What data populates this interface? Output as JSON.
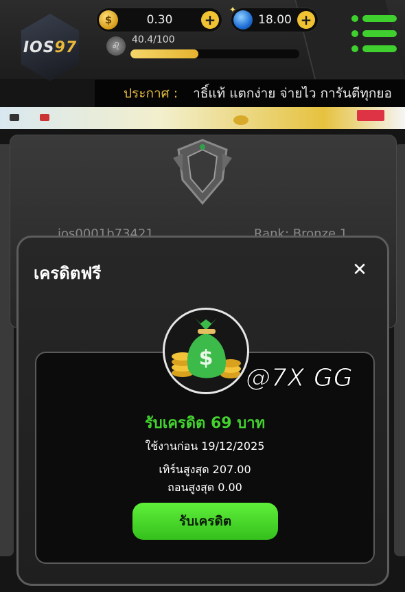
{
  "header": {
    "logo_text_main": "IOS",
    "logo_text_num": "97",
    "coin_balance": "0.30",
    "gem_balance": "18.00",
    "exp_text": "40.4/100",
    "exp_progress": 0.404,
    "coin_symbol": "$",
    "plus_symbol": "+"
  },
  "announcement": {
    "label": "ประกาศ :",
    "text": "าธิ์แท้ แตกง่าย จ่ายไว การันตีทุกยอ"
  },
  "profile": {
    "username": "ios0001b73421",
    "rank": "Rank: Bronze 1"
  },
  "modal": {
    "title": "เครดิตฟรี",
    "close_symbol": "✕",
    "reward_title": "รับเครดิต 69 บาท",
    "use_before": "ใช้งานก่อน 19/12/2025",
    "max_turnover": "เทิร์นสูงสุด 207.00",
    "max_withdraw": "ถอนสูงสุด 0.00",
    "claim_button": "รับเครดิต",
    "watermark": "@7X GG"
  },
  "colors": {
    "accent_green": "#43d22f",
    "gold": "#e6bd40"
  },
  "icons": {
    "coin": "coin-icon",
    "gem": "gem-icon",
    "menu": "menu-icon",
    "close": "close-icon",
    "money_bag": "money-bag-icon"
  }
}
